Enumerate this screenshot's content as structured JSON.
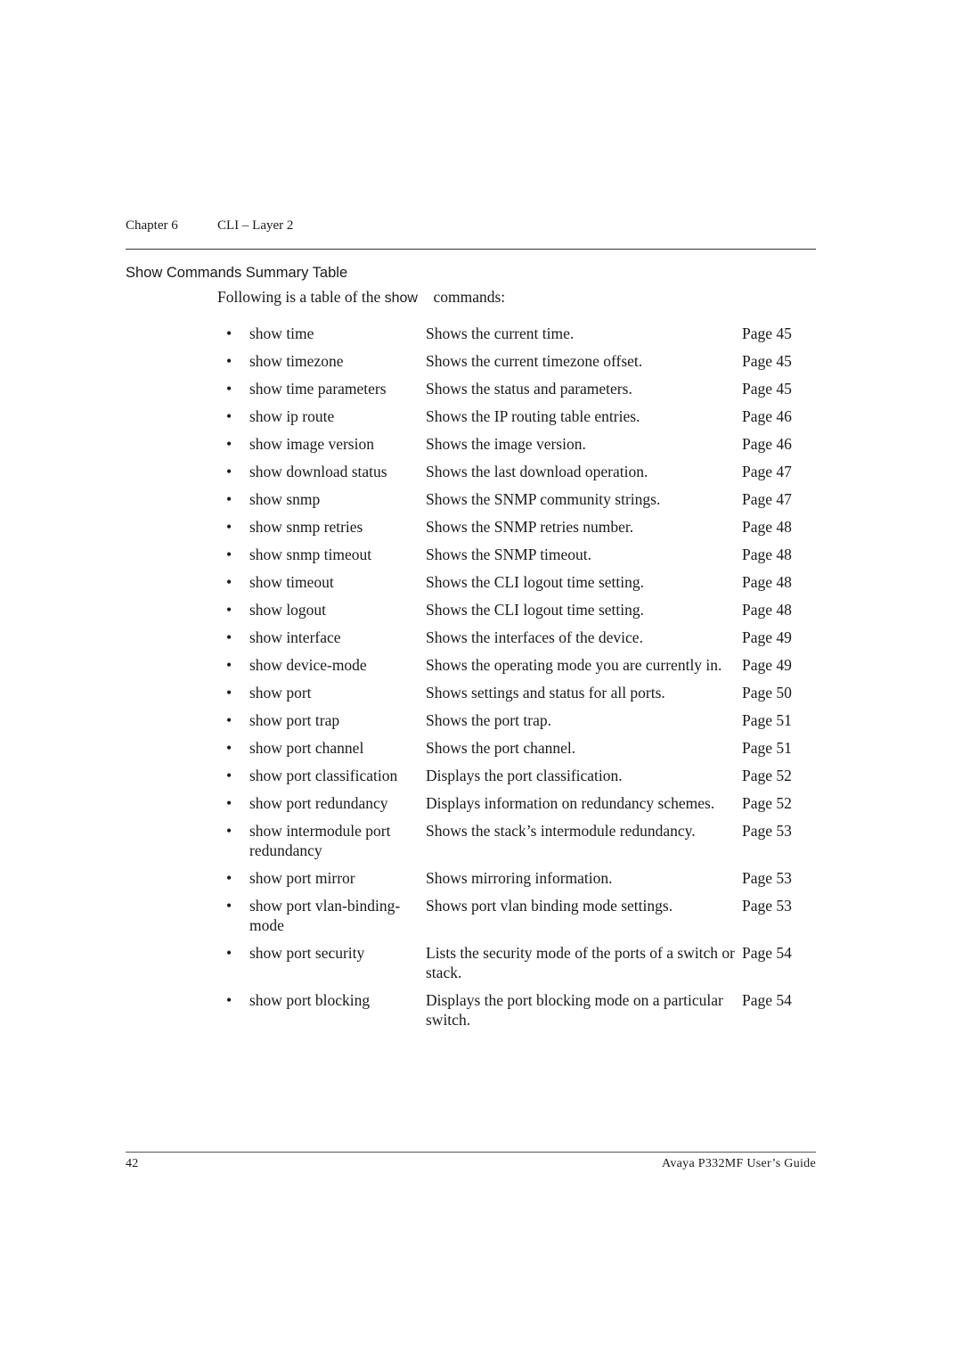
{
  "header": {
    "chapter": "Chapter 6",
    "title": "CLI – Layer 2"
  },
  "section": {
    "title": "Show Commands Summary Table",
    "intro_before": "Following is a table of the ",
    "intro_code": "show",
    "intro_after": "commands:"
  },
  "commands": [
    {
      "cmd": "show time",
      "desc": "Shows the current time.",
      "page": "Page 45"
    },
    {
      "cmd": "show timezone",
      "desc": "Shows the current timezone offset.",
      "page": "Page 45"
    },
    {
      "cmd": "show time parameters",
      "desc": "Shows the status and parameters.",
      "page": "Page 45"
    },
    {
      "cmd": "show ip route",
      "desc": "Shows the IP routing table entries.",
      "page": "Page 46"
    },
    {
      "cmd": "show image version",
      "desc": "Shows the image version.",
      "page": "Page 46"
    },
    {
      "cmd": "show download status",
      "desc": "Shows the last download operation.",
      "page": "Page 47"
    },
    {
      "cmd": "show snmp",
      "desc": "Shows the SNMP community strings.",
      "page": "Page 47"
    },
    {
      "cmd": "show snmp retries",
      "desc": "Shows the SNMP retries number.",
      "page": "Page 48"
    },
    {
      "cmd": "show snmp timeout",
      "desc": "Shows the SNMP timeout.",
      "page": "Page 48"
    },
    {
      "cmd": "show timeout",
      "desc": "Shows the CLI logout time setting.",
      "page": "Page 48"
    },
    {
      "cmd": "show logout",
      "desc": "Shows the CLI logout time setting.",
      "page": "Page 48"
    },
    {
      "cmd": "show interface",
      "desc": "Shows the interfaces of the device.",
      "page": "Page 49"
    },
    {
      "cmd": "show device-mode",
      "desc": "Shows the operating mode you are currently in.",
      "page": "Page 49"
    },
    {
      "cmd": "show port",
      "desc": "Shows settings and status for all ports.",
      "page": "Page 50"
    },
    {
      "cmd": "show port trap",
      "desc": "Shows the port trap.",
      "page": "Page 51"
    },
    {
      "cmd": "show port channel",
      "desc": "Shows the port channel.",
      "page": "Page 51"
    },
    {
      "cmd": "show port classification",
      "desc": "Displays the port classification.",
      "page": "Page 52"
    },
    {
      "cmd": "show port redundancy",
      "desc": "Displays information on redundancy schemes.",
      "page": "Page 52"
    },
    {
      "cmd": "show intermodule port redundancy",
      "desc": "Shows the stack’s intermodule redundancy.",
      "page": "Page 53"
    },
    {
      "cmd": "show port mirror",
      "desc": "Shows mirroring information.",
      "page": "Page 53"
    },
    {
      "cmd": "show port vlan-binding-mode",
      "desc": "Shows port vlan binding mode settings.",
      "page": "Page 53"
    },
    {
      "cmd": "show port security",
      "desc": "Lists the security mode of the ports of a switch or stack.",
      "page": "Page 54"
    },
    {
      "cmd": "show port blocking",
      "desc": "Displays the port blocking mode on a particular switch.",
      "page": "Page 54"
    }
  ],
  "bullet": "•",
  "footer": {
    "page_number": "42",
    "guide_title": "Avaya P332MF User’s Guide"
  }
}
